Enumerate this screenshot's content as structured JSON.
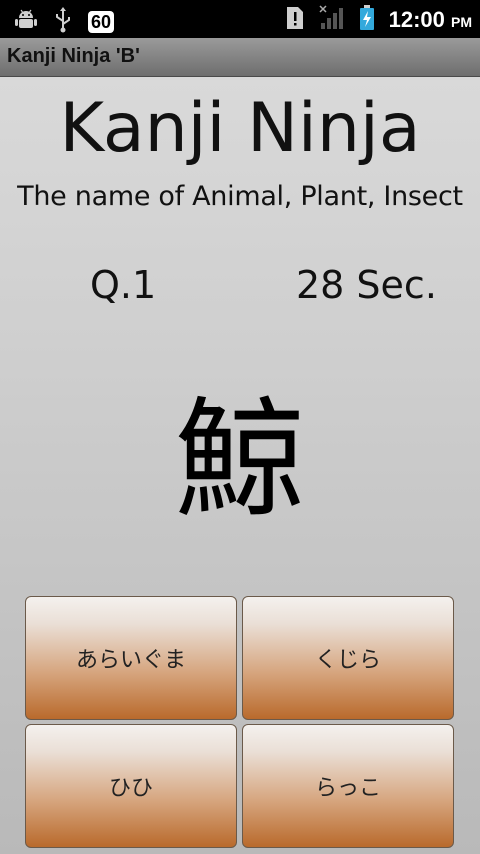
{
  "status_bar": {
    "notification_count": "60",
    "time": "12:00",
    "ampm": "PM",
    "icons": [
      "android-debug-icon",
      "usb-icon",
      "alert-icon",
      "signal-icon",
      "battery-charging-icon"
    ]
  },
  "title_bar": {
    "title": "Kanji Ninja 'B'"
  },
  "main": {
    "app_title": "Kanji Ninja",
    "subtitle": "The name of Animal, Plant, Insect",
    "question": "Q.1",
    "timer": "28 Sec.",
    "kanji": "鯨"
  },
  "answers": [
    {
      "label": "あらいぐま"
    },
    {
      "label": "くじら"
    },
    {
      "label": "ひひ"
    },
    {
      "label": "らっこ"
    }
  ]
}
